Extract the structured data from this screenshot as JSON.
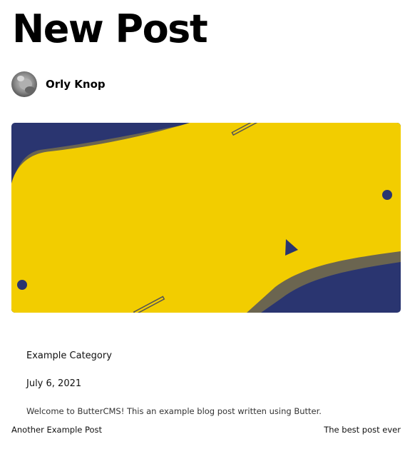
{
  "post": {
    "title": "New Post",
    "author_name": "Orly Knop",
    "category": "Example Category",
    "date": "July 6, 2021",
    "excerpt": "Welcome to ButterCMS! This an example blog post written using Butter."
  },
  "navigation": {
    "previous_label": "Another Example Post",
    "next_label": "The best post ever"
  },
  "colors": {
    "hero_navy": "#2a3570",
    "hero_yellow": "#f2cd00",
    "hero_shadow": "#6b6550"
  }
}
